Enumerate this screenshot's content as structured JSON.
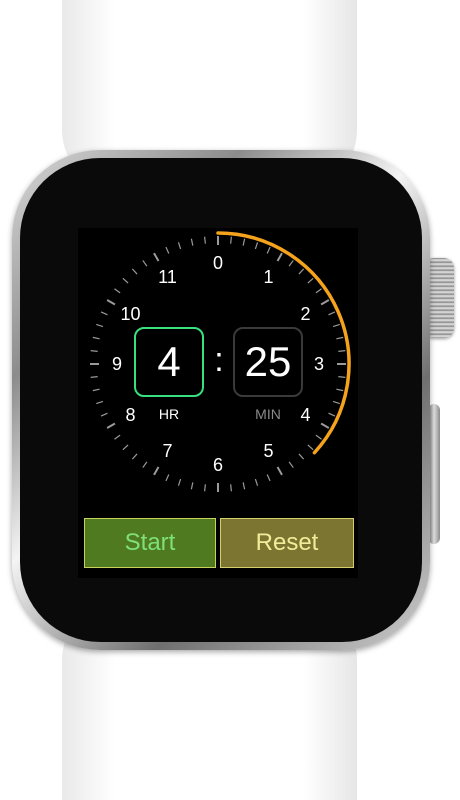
{
  "timer": {
    "hours": "4",
    "minutes": "25",
    "separator": ":",
    "hours_label": "HR",
    "minutes_label": "MIN",
    "selected_field": "hours"
  },
  "dial": {
    "numbers": [
      "0",
      "1",
      "2",
      "3",
      "4",
      "5",
      "6",
      "7",
      "8",
      "9",
      "10",
      "11"
    ],
    "progress_start_hour": 0,
    "progress_end_hour": 4.42,
    "progress_color": "#f5a21c",
    "tick_color": "#9a9a9a"
  },
  "actions": {
    "start_label": "Start",
    "reset_label": "Reset"
  },
  "colors": {
    "selected_border": "#39e07f",
    "start_button": "#4f7a1f",
    "reset_button": "#7c7431"
  }
}
